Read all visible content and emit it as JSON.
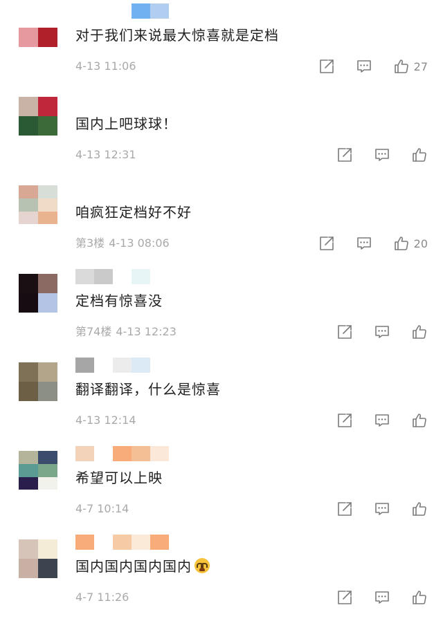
{
  "comments": [
    {
      "avatar": [
        "#ffffff",
        "#ffffff",
        "#e69aa0",
        "#b0202a"
      ],
      "username_blur": [
        "#ffffff",
        "#ffffff",
        "#ffffff",
        "#5fa8f0",
        "#a9c9ee"
      ],
      "text": "对于我们来说最大惊喜就是定档",
      "floor": "",
      "time": "4-13 11:06",
      "likes": "27",
      "emoji": false
    },
    {
      "avatar": [
        "#c9b3a7",
        "#c0273a",
        "#2a5a33",
        "#3c6a39"
      ],
      "username_blur": [
        "#ffffff",
        "#ffffff",
        "#ffffff",
        "#ffffff",
        "#ffffff"
      ],
      "text": "国内上吧球球！",
      "floor": "",
      "time": "4-13 12:31",
      "likes": "",
      "emoji": false
    },
    {
      "avatar": [
        "#d9a894",
        "#d7ddd7",
        "#b8c2b2",
        "#f0dcc6",
        "#e6d4d0",
        "#e8b38e"
      ],
      "username_blur": [
        "#ffffff",
        "#ffffff",
        "#ffffff",
        "#ffffff",
        "#ffffff"
      ],
      "text": "咱疯狂定档好不好",
      "floor": "第3楼",
      "time": "4-13 08:06",
      "likes": "20",
      "emoji": false
    },
    {
      "avatar": [
        "#1a1014",
        "#8a6a62",
        "#160c12",
        "#b4c4e4"
      ],
      "username_blur": [
        "#d6d6d6",
        "#c4c4c4",
        "#ffffff",
        "#e6f4f6",
        "#ffffff"
      ],
      "text": "定档有惊喜没",
      "floor": "第74楼",
      "time": "4-13 12:23",
      "likes": "",
      "emoji": false
    },
    {
      "avatar": [
        "#7e7156",
        "#b3a58a",
        "#6d5f45",
        "#8b8f86"
      ],
      "username_blur": [
        "#9c9c9c",
        "#ffffff",
        "#eaeaea",
        "#d8e8f4",
        "#ffffff"
      ],
      "text": "翻译翻译，什么是惊喜",
      "floor": "",
      "time": "4-13 12:14",
      "likes": "",
      "emoji": false
    },
    {
      "avatar": [
        "#b4b49a",
        "#3c4c6c",
        "#5a9c94",
        "#7aa68a",
        "#2a1e4c",
        "#f2f2ec"
      ],
      "username_blur": [
        "#f2cfb4",
        "#ffffff",
        "#f6a36a",
        "#f4b88a",
        "#fbe6d4"
      ],
      "text": "希望可以上映",
      "floor": "",
      "time": "4-7 10:14",
      "likes": "",
      "emoji": false
    },
    {
      "avatar": [
        "#d6c4b8",
        "#f4ecd6",
        "#c8b0a4",
        "#3c4450"
      ],
      "username_blur": [
        "#f6a36a",
        "#ffffff",
        "#f4c49a",
        "#fbe8d4",
        "#f6a36a"
      ],
      "text": "国内国内国内国内",
      "floor": "",
      "time": "4-7 11:26",
      "likes": "",
      "emoji": true
    }
  ],
  "icons": {
    "share": "share-icon",
    "comment": "comment-icon",
    "like": "like-icon"
  },
  "colors": {
    "meta_text": "#a9a9a9",
    "icon_stroke": "#7a7a7a"
  }
}
